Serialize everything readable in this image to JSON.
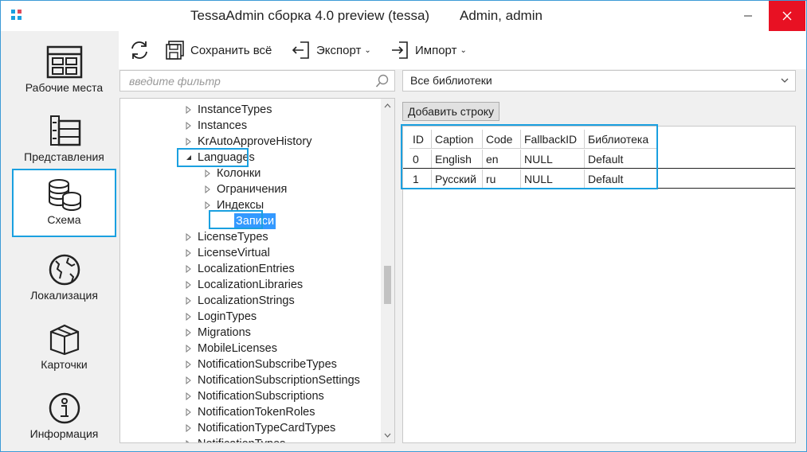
{
  "window": {
    "title": "TessaAdmin сборка 4.0 preview (tessa)",
    "user": "Admin, admin",
    "accent": "#1aa0e0",
    "close_color": "#e81123"
  },
  "sidebar": {
    "items": [
      {
        "label": "Рабочие места",
        "icon": "workplaces-icon"
      },
      {
        "label": "Представления",
        "icon": "views-icon"
      },
      {
        "label": "Схема",
        "icon": "database-icon",
        "selected": true
      },
      {
        "label": "Локализация",
        "icon": "globe-icon"
      },
      {
        "label": "Карточки",
        "icon": "box-icon"
      },
      {
        "label": "Информация",
        "icon": "info-icon"
      }
    ]
  },
  "toolbar": {
    "refresh_icon": "refresh-icon",
    "save_all": "Сохранить всё",
    "export": "Экспорт",
    "import": "Импорт"
  },
  "filter": {
    "placeholder": "введите фильтр",
    "value": ""
  },
  "library_select": {
    "value": "Все библиотеки"
  },
  "tree": {
    "items": [
      {
        "label": "InstanceTypes",
        "state": "collapsed"
      },
      {
        "label": "Instances",
        "state": "collapsed"
      },
      {
        "label": "KrAutoApproveHistory",
        "state": "collapsed"
      },
      {
        "label": "Languages",
        "state": "expanded"
      },
      {
        "label": "Колонки",
        "state": "collapsed"
      },
      {
        "label": "Ограничения",
        "state": "collapsed"
      },
      {
        "label": "Индексы",
        "state": "collapsed"
      },
      {
        "label": "Записи",
        "state": "selected"
      },
      {
        "label": "LicenseTypes",
        "state": "collapsed"
      },
      {
        "label": "LicenseVirtual",
        "state": "collapsed"
      },
      {
        "label": "LocalizationEntries",
        "state": "collapsed"
      },
      {
        "label": "LocalizationLibraries",
        "state": "collapsed"
      },
      {
        "label": "LocalizationStrings",
        "state": "collapsed"
      },
      {
        "label": "LoginTypes",
        "state": "collapsed"
      },
      {
        "label": "Migrations",
        "state": "collapsed"
      },
      {
        "label": "MobileLicenses",
        "state": "collapsed"
      },
      {
        "label": "NotificationSubscribeTypes",
        "state": "collapsed"
      },
      {
        "label": "NotificationSubscriptionSettings",
        "state": "collapsed"
      },
      {
        "label": "NotificationSubscriptions",
        "state": "collapsed"
      },
      {
        "label": "NotificationTokenRoles",
        "state": "collapsed"
      },
      {
        "label": "NotificationTypeCardTypes",
        "state": "collapsed"
      },
      {
        "label": "NotificationTypes",
        "state": "collapsed"
      }
    ]
  },
  "records": {
    "add_row": "Добавить строку",
    "columns": [
      "ID",
      "Caption",
      "Code",
      "FallbackID",
      "Библиотека"
    ],
    "rows": [
      [
        "0",
        "English",
        "en",
        "NULL",
        "Default"
      ],
      [
        "1",
        "Русский",
        "ru",
        "NULL",
        "Default"
      ]
    ]
  }
}
